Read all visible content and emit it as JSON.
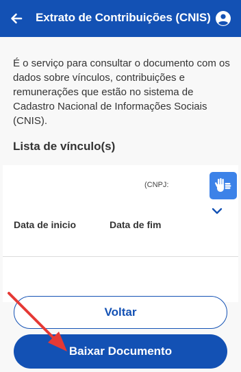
{
  "header": {
    "title": "Extrato de Contribuições (CNIS)",
    "back_icon": "arrow-left-icon",
    "account_icon": "user-circle-icon",
    "bg_color": "#1351b4"
  },
  "content": {
    "description": "É o serviço para consultar o documento com os dados sobre vínculos, contribuições e remunerações que estão no sistema de Cadastro Nacional de Informações Sociais (CNIS).",
    "section_title": "Lista de vínculo(s)",
    "vinculo": {
      "cnpj_label": "(CNPJ:",
      "col_start_label": "Data de inicio",
      "col_end_label": "Data de fim"
    }
  },
  "accessibility": {
    "icon": "vlibras-hands-icon",
    "color": "#3c82e8"
  },
  "actions": {
    "back_label": "Voltar",
    "download_label": "Baixar Documento"
  },
  "annotation": {
    "arrow_color": "#e53935"
  }
}
